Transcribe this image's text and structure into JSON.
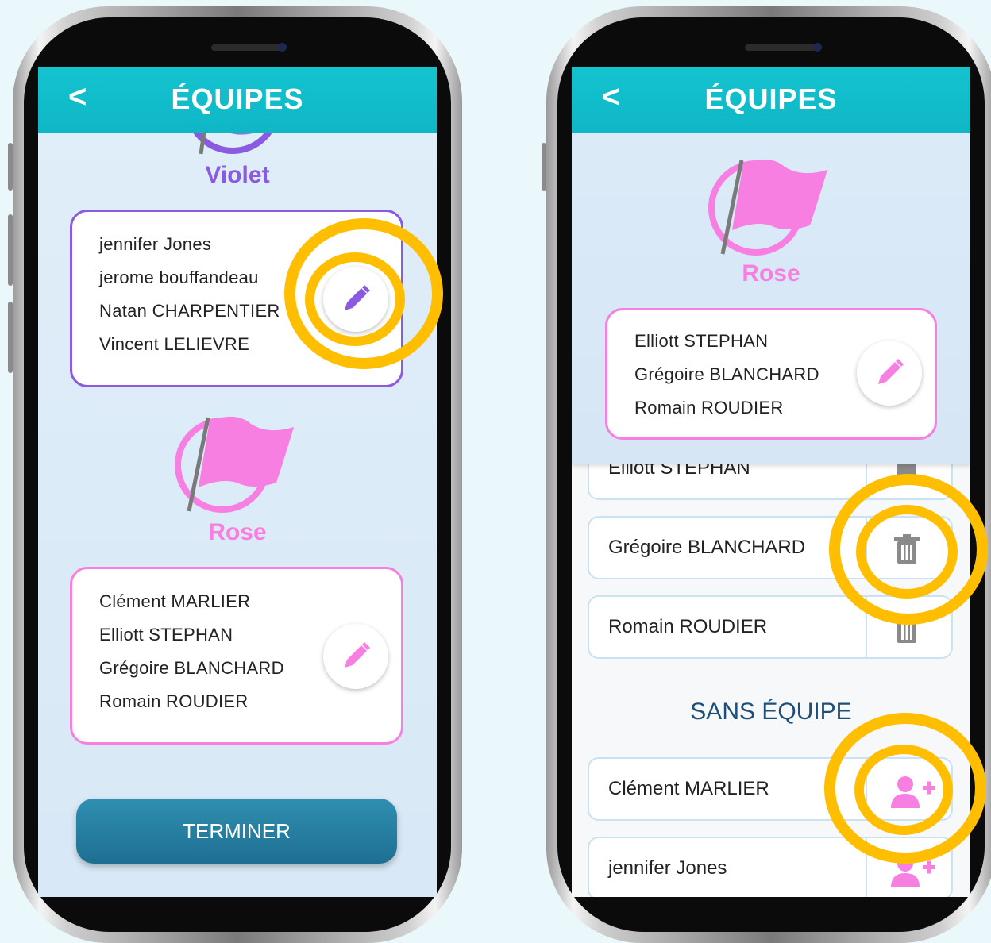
{
  "colors": {
    "teal": "#12bfcc",
    "violet": "#8a5be0",
    "rose": "#f77fe1",
    "highlight": "#ffbf00"
  },
  "left": {
    "header": {
      "back_icon": "chevron-left-icon",
      "back_label": "<",
      "title": "ÉQUIPES"
    },
    "team_violet": {
      "name": "Violet",
      "members": [
        "jennifer Jones",
        "jerome bouffandeau",
        "Natan CHARPENTIER",
        "Vincent LELIEVRE"
      ],
      "edit_icon": "pencil-icon"
    },
    "team_rose": {
      "name": "Rose",
      "members": [
        "Clément MARLIER",
        "Elliott STEPHAN",
        "Grégoire BLANCHARD",
        "Romain ROUDIER"
      ],
      "edit_icon": "pencil-icon"
    },
    "finish_label": "TERMINER"
  },
  "right": {
    "header": {
      "back_icon": "chevron-left-icon",
      "back_label": "<",
      "title": "ÉQUIPES"
    },
    "team_rose": {
      "name": "Rose",
      "members": [
        "Elliott STEPHAN",
        "Grégoire BLANCHARD",
        "Romain ROUDIER"
      ],
      "edit_icon": "pencil-icon"
    },
    "team_list": [
      {
        "name": "Elliott STEPHAN",
        "icon": "trash-icon"
      },
      {
        "name": "Grégoire BLANCHARD",
        "icon": "trash-icon"
      },
      {
        "name": "Romain ROUDIER",
        "icon": "trash-icon"
      }
    ],
    "no_team_title": "SANS ÉQUIPE",
    "no_team_list": [
      {
        "name": "Clément MARLIER",
        "icon": "add-user-icon"
      },
      {
        "name": "jennifer Jones",
        "icon": "add-user-icon"
      }
    ]
  }
}
